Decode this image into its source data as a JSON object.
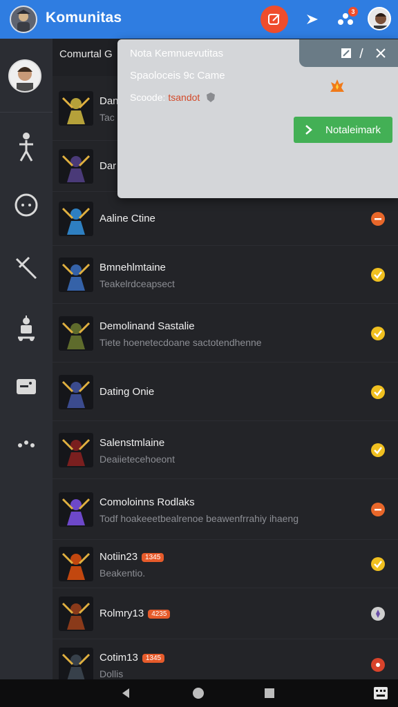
{
  "header": {
    "title": "Komunitas",
    "notification_count": "3"
  },
  "list": {
    "header": "Comurtal G",
    "rows": [
      {
        "name": "Dan",
        "sub": "Tac",
        "status": "none",
        "art": "#b5a13a"
      },
      {
        "name": "Dar",
        "sub": "",
        "status": "none",
        "art": "#4a3a78"
      },
      {
        "name": "Aaline Ctine",
        "sub": "",
        "status": "orange",
        "art": "#2e7fc1"
      },
      {
        "name": "Bmnehlmtaine",
        "sub": "Teakelrdceapsect",
        "status": "yellow",
        "art": "#3562a8"
      },
      {
        "name": "Demolinand Sastalie",
        "sub": "Tiete hoenetecdoane sactotendhenne",
        "status": "yellow",
        "art": "#5e6b2c"
      },
      {
        "name": "Dating Onie",
        "sub": "",
        "status": "yellow",
        "art": "#3b4b8e"
      },
      {
        "name": "Salenstmlaine",
        "sub": "Deaiietecehoeont",
        "status": "yellow",
        "art": "#7a1f1f"
      },
      {
        "name": "Comoloinns Rodlaks",
        "sub": "Todf hoakeeetbealrenoe beawenfrrahiy ihaeng",
        "status": "orange",
        "art": "#6d48c9"
      },
      {
        "name": "Notiin23",
        "sub": "Beakentio.",
        "tag": "1345",
        "status": "yellow",
        "art": "#c2470f"
      },
      {
        "name": "Rolmry13",
        "sub": "",
        "tag": "4235",
        "status": "gray",
        "art": "#8a3a1a"
      },
      {
        "name": "Cotim13",
        "sub": "Dollis",
        "tag": "1345",
        "status": "red",
        "art": "#37404a"
      }
    ]
  },
  "popup": {
    "title": "Nota Kemnuevutitas",
    "line": "Spaoloceis 9c Came",
    "sub_label": "Scoode:",
    "sub_accent": "tsandot",
    "action_label": "Notaleimark"
  },
  "colors": {
    "topbar": "#2f7de1",
    "accent_red": "#ef4d2c",
    "success": "#43b055",
    "status_yellow": "#f0c020",
    "status_orange": "#e8672a"
  }
}
